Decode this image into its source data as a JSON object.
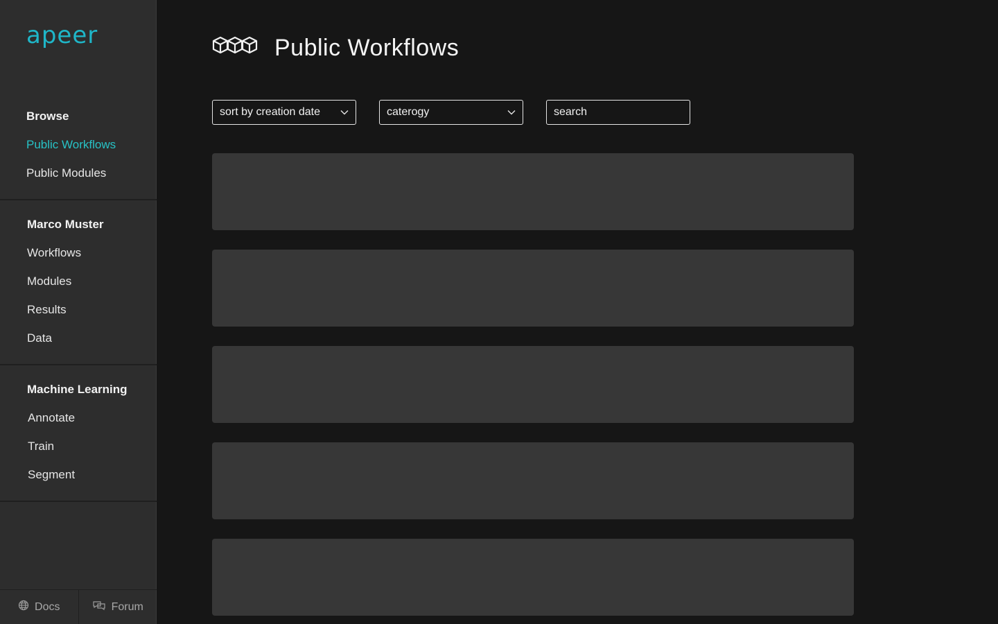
{
  "app": {
    "logo_text": "apeer",
    "accent_color": "#27c2c6",
    "logo_color": "#1fb6c8"
  },
  "sidebar": {
    "sections": [
      {
        "title": "Browse",
        "items": [
          {
            "label": "Public Workflows",
            "active": true
          },
          {
            "label": "Public Modules",
            "active": false
          }
        ]
      },
      {
        "title": "Marco Muster",
        "items": [
          {
            "label": "Workflows",
            "active": false
          },
          {
            "label": "Modules",
            "active": false
          },
          {
            "label": "Results",
            "active": false
          },
          {
            "label": "Data",
            "active": false
          }
        ]
      },
      {
        "title": "Machine Learning",
        "items": [
          {
            "label": "Annotate",
            "active": false
          },
          {
            "label": "Train",
            "active": false
          },
          {
            "label": "Segment",
            "active": false
          }
        ]
      }
    ],
    "footer": {
      "docs_label": "Docs",
      "docs_icon": "globe-icon",
      "forum_label": "Forum",
      "forum_icon": "chat-icon"
    }
  },
  "main": {
    "title": "Public Workflows",
    "title_icon": "workflow-cubes-icon",
    "sort_select": {
      "value": "sort by creation date"
    },
    "category_select": {
      "value": "caterogy"
    },
    "search": {
      "placeholder": "search"
    },
    "cards_count": 5
  }
}
